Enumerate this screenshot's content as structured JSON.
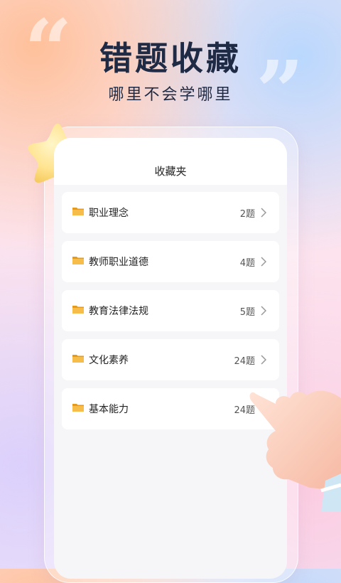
{
  "hero": {
    "title": "错题收藏",
    "subtitle": "哪里不会学哪里"
  },
  "screen": {
    "header_title": "收藏夹",
    "items": [
      {
        "label": "职业理念",
        "count": "2题",
        "has_chevron": true
      },
      {
        "label": "教师职业道德",
        "count": "4题",
        "has_chevron": true
      },
      {
        "label": "教育法律法规",
        "count": "5题",
        "has_chevron": true
      },
      {
        "label": "文化素养",
        "count": "24题",
        "has_chevron": true
      },
      {
        "label": "基本能力",
        "count": "24题",
        "has_chevron": false
      }
    ]
  },
  "icons": {
    "folder": "folder-icon",
    "chevron": "chevron-right-icon",
    "star": "star-icon",
    "hand": "pointing-hand-icon",
    "quote": "quote-mark-icon"
  },
  "colors": {
    "title": "#1f2a44",
    "folder": "#f0a92a",
    "card": "#ffffff",
    "screen_bg": "#f6f6f8"
  }
}
